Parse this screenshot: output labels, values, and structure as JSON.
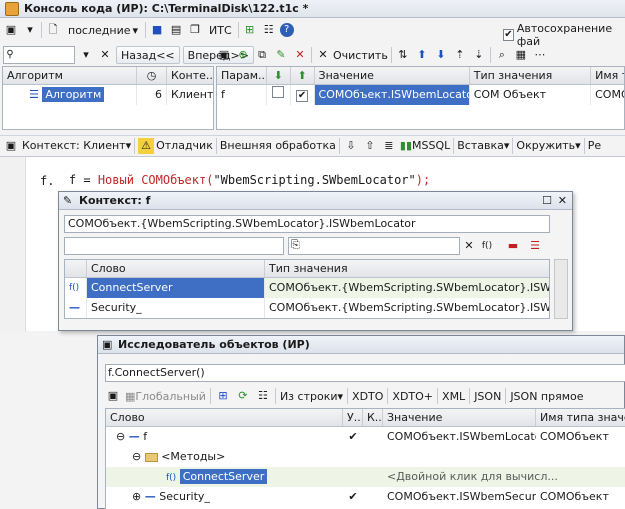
{
  "window": {
    "title": "Консоль кода (ИР): C:\\TerminalDisk\\122.t1c *"
  },
  "toolbar1": {
    "recent_label": "последние",
    "its_label": "ИТС",
    "autosave_label": "Автосохранение фай"
  },
  "toolbar2": {
    "back_label": "Назад<<",
    "forward_label": "Вперед>>"
  },
  "params_toolbar": {
    "clear_label": "Очистить"
  },
  "algorithms": {
    "columns": [
      "Алгоритм",
      "Конте..."
    ],
    "rows": [
      {
        "name": "Алгоритм",
        "count": "6",
        "context": "Клиент"
      }
    ]
  },
  "params": {
    "columns": [
      "Парам...",
      "Значение",
      "Тип значения",
      "Имя т"
    ],
    "rows": [
      {
        "name": "f",
        "value": "COMОбъект.ISWbemLocator",
        "type": "COM Объект",
        "type_name": "COMO"
      }
    ]
  },
  "editor_toolbar": {
    "context_label": "Контекст: Клиент",
    "debugger_label": "Отладчик",
    "external_label": "Внешняя обработка",
    "mssql_label": "MSSQL",
    "insert_label": "Вставка",
    "wrap_label": "Окружить",
    "tail_label": "Ре"
  },
  "code": {
    "line1": {
      "var": "f",
      "op": " = ",
      "kw1": "Новый",
      "kw2": "COMОбъект",
      "open": "(",
      "str": "\"WbemScripting.SWbemLocator\"",
      "close": ");"
    },
    "line2": "f."
  },
  "context_popup": {
    "title": "Контекст: f",
    "path": "COMОбъект.{WbemScripting.SWbemLocator}.ISWbemLocator",
    "columns": [
      "Слово",
      "Тип значения"
    ],
    "rows": [
      {
        "icon": "f()",
        "word": "ConnectServer",
        "type": "COMОбъект.{WbemScripting.SWbemLocator}.ISWbem..."
      },
      {
        "icon": "—",
        "word": "Security_",
        "type": "COMОбъект.{WbemScripting.SWbemLocator}.ISWbem..."
      }
    ]
  },
  "explorer": {
    "title": "Исследователь объектов (ИР)",
    "expression": "f.ConnectServer()",
    "global_label": "Глобальный",
    "from_string_label": "Из строки",
    "buttons": [
      "XDTO",
      "XDTO+",
      "XML",
      "JSON",
      "JSON прямое"
    ],
    "columns": [
      "Слово",
      "У...",
      "К...",
      "Значение",
      "Имя типа значе"
    ],
    "rows": [
      {
        "tree": "⊖",
        "icon": "—",
        "word": "f",
        "check": "✔",
        "value": "COMОбъект.ISWbemLocator",
        "type": "COMОбъект"
      },
      {
        "tree": "⊖",
        "icon": "folder",
        "word": "<Методы>",
        "check": "",
        "value": "",
        "type": ""
      },
      {
        "tree": "",
        "icon": "f()",
        "word": "ConnectServer",
        "check": "",
        "value": "<Двойной клик для вычисл...",
        "type": ""
      },
      {
        "tree": "⊕",
        "icon": "—",
        "word": "Security_",
        "check": "✔",
        "value": "COMОбъект.ISWbemSecurity",
        "type": "COMОбъект"
      }
    ]
  }
}
